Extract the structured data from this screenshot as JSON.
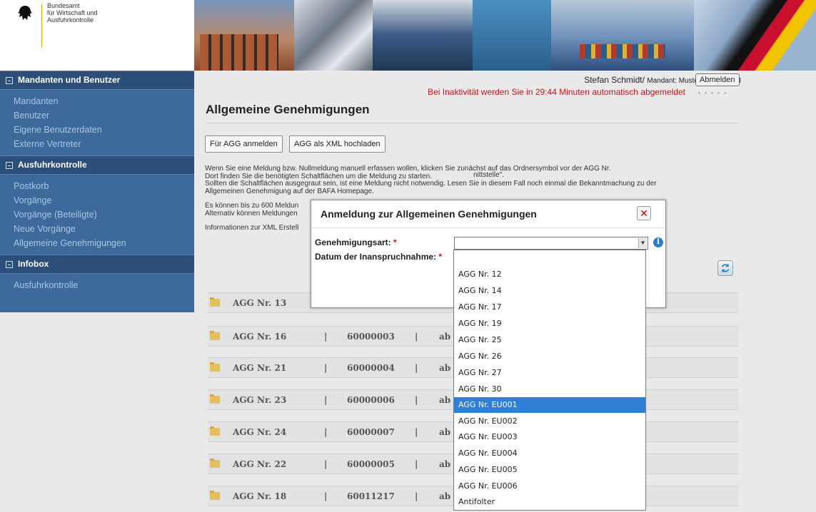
{
  "header": {
    "logo_text": "Bundesamt\nfür Wirtschaft und\nAusfuhrkontrolle"
  },
  "user": {
    "name": "Stefan Schmidt/",
    "mandant": "Mandant: Mustermann GmbH",
    "logout_label": "Abmelden",
    "timeout_message": "Bei Inaktivität werden Sie in 29:44 Minuten automatisch abgemeldet",
    "dots": "• • • • •"
  },
  "sidebar": {
    "sections": [
      {
        "title": "Mandanten und Benutzer",
        "items": [
          "Mandanten",
          "Benutzer",
          "Eigene Benutzerdaten",
          "Externe Vertreter"
        ]
      },
      {
        "title": "Ausfuhrkontrolle",
        "items": [
          "Postkorb",
          "Vorgänge",
          "Vorgänge (Beteiligte)",
          "Neue Vorgänge",
          "Allgemeine Genehmigungen"
        ]
      },
      {
        "title": "Infobox",
        "items": [
          "Ausfuhrkontrolle"
        ]
      }
    ]
  },
  "main": {
    "title": "Allgemeine Genehmigungen",
    "buttons": {
      "register": "Für AGG anmelden",
      "upload_xml": "AGG als XML hochladen"
    },
    "info": {
      "line1": "Wenn Sie eine Meldung bzw. Nullmeldung manuell erfassen wollen, klicken Sie zunächst auf das Ordnersymbol vor der AGG Nr.",
      "line2": "Dort finden Sie die benötigten Schaltflächen um die Meldung zu starten.",
      "line3": "Sollten die Schaltflächen ausgegraut sein, ist eine Meldung nicht notwendig. Lesen Sie in diesem Fall noch einmal die Bekanntmachung zu der",
      "line4": "Allgemeinen Genehmigung auf der BAFA Homepage.",
      "line5": "Es können bis zu 600 Meldun",
      "line6": "Alternativ können Meldungen",
      "line7": "Informationen zur XML Erstell",
      "line7_tail": "nittstelle\"."
    },
    "rows": [
      {
        "name": "AGG Nr. 13",
        "number": "",
        "ab": ""
      },
      {
        "name": "AGG Nr. 16",
        "number": "60000003",
        "ab": "ab"
      },
      {
        "name": "AGG Nr. 21",
        "number": "60000004",
        "ab": "ab"
      },
      {
        "name": "AGG Nr. 23",
        "number": "60000006",
        "ab": "ab"
      },
      {
        "name": "AGG Nr. 24",
        "number": "60000007",
        "ab": "ab"
      },
      {
        "name": "AGG Nr. 22",
        "number": "60000005",
        "ab": "ab"
      },
      {
        "name": "AGG Nr. 18",
        "number": "60011217",
        "ab": "ab"
      }
    ],
    "row_separator": "|"
  },
  "modal": {
    "title": "Anmeldung zur Allgemeinen Genehmigungen",
    "close_label": "✕",
    "field_type_label": "Genehmigungsart:",
    "field_date_label": "Datum der Inanspruchnahme:",
    "required_mark": "*",
    "select_value": "",
    "info_icon": "i"
  },
  "dropdown": {
    "options": [
      "",
      "AGG Nr. 12",
      "AGG Nr. 14",
      "AGG Nr. 17",
      "AGG Nr. 19",
      "AGG Nr. 25",
      "AGG Nr. 26",
      "AGG Nr. 27",
      "AGG Nr. 30",
      "AGG Nr. EU001",
      "AGG Nr. EU002",
      "AGG Nr. EU003",
      "AGG Nr. EU004",
      "AGG Nr. EU005",
      "AGG Nr. EU006",
      "Antifolter"
    ],
    "selected": "AGG Nr. EU001"
  },
  "colors": {
    "sidebar": "#3d6a9b",
    "sidebar_header": "#2b4f78",
    "warning": "#c4161c",
    "dropdown_selected": "#2f7fd7"
  }
}
